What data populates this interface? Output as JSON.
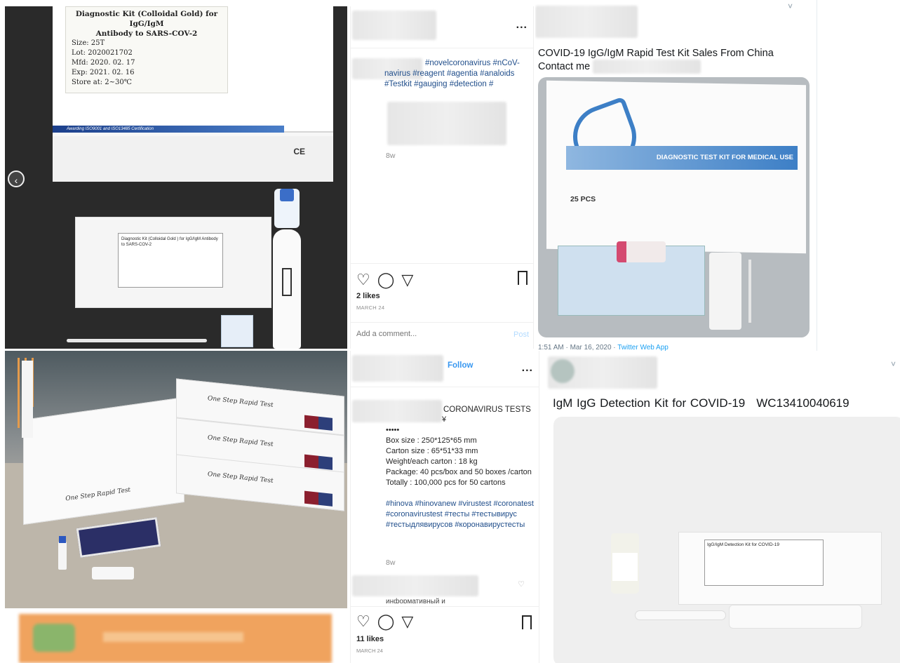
{
  "photo1": {
    "label": {
      "title_line1": "Diagnostic Kit (Colloidal Gold) for IgG/IgM",
      "title_line2": "Antibody to SARS-COV-2",
      "rows": [
        "Size:   25T",
        "Lot:    2020021702",
        "Mfd:    2020. 02. 17",
        "Exp:    2021. 02. 16",
        "Store at:  2~30℃"
      ]
    },
    "stripe_text": "Awarding ISO9001 and ISO13485 Certification",
    "ce_mark": "CE",
    "pouch_text": "Diagnostic Kit (Colloidal Gold ) for IgG/IgM Antibody to SARS-COV-2",
    "prev_icon": "chevron-left-icon"
  },
  "ig_post1": {
    "caption_text": "#novelcoronavirus #nCoV-navirus #reagent #agentia #analoids #Testkit #gauging #detection #",
    "age": "8w",
    "likes": "2 likes",
    "date": "MARCH 24",
    "comment_placeholder": "Add a comment...",
    "post_label": "Post",
    "more": "...",
    "icons": [
      "heart-icon",
      "comment-icon",
      "share-icon",
      "bookmark-icon"
    ]
  },
  "tweet1": {
    "text": "COVID-19 IgG/IgM Rapid Test Kit Sales From China Contact me",
    "image_band": "DIAGNOSTIC TEST KIT FOR MEDICAL USE",
    "image_count": "25 PCS",
    "meta_time": "1:51 AM · Mar 16, 2020 · ",
    "meta_source": "Twitter Web App",
    "chevron": "˅"
  },
  "photo2": {
    "box_text": "One Step Rapid Test"
  },
  "ig_post2": {
    "follow": "Follow",
    "more": "...",
    "caption_title": "CORONAVIRUS TESTS",
    "currency": "¥",
    "body_lines": [
      "•••••",
      "Box size : 250*125*65 mm",
      "Carton size : 65*51*33 mm",
      "Weight/each carton : 18 kg",
      "Package: 40 pcs/box and 50 boxes /carton",
      "Totally : 100,000 pcs for 50 cartons"
    ],
    "hashtags": "#hinova #hinovanew #virustest #coronatest #coronavirustest #тесты #тестывирус #тестыдлявирусов #коронавирустесты",
    "age": "8w",
    "comment_peek": "информативный и познавательный пост!",
    "likes": "11 likes",
    "date": "MARCH 24"
  },
  "tweet2": {
    "text": "IgM IgG Detection Kit for COVID-19",
    "code": "WC13410040619",
    "pouch_label": "IgG/IgM Detection Kit for COVID-19",
    "chevron": "˅"
  }
}
